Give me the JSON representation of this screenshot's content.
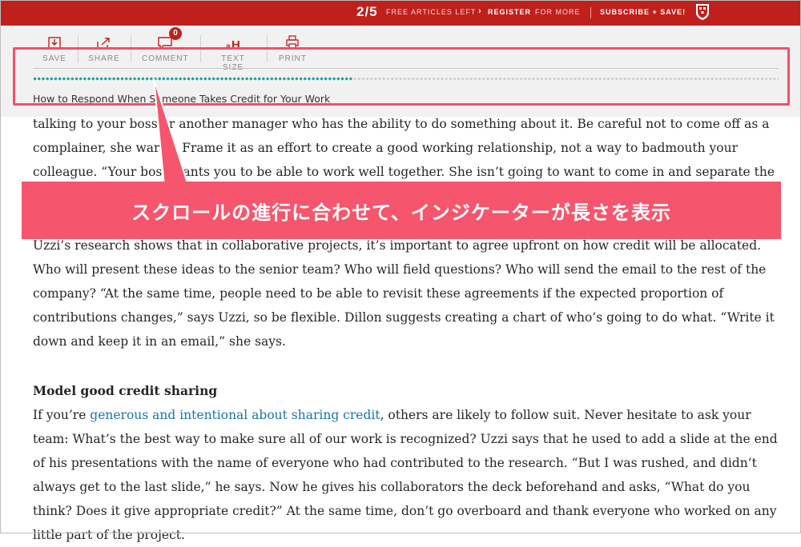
{
  "topbar": {
    "count": "2/5",
    "free_articles": "FREE ARTICLES LEFT",
    "register": "REGISTER",
    "for_more": "FOR MORE",
    "subscribe": "SUBSCRIBE + SAVE!",
    "brand_color": "#c0201b"
  },
  "toolbar": {
    "tools": [
      {
        "label": "SAVE",
        "icon": "save-icon"
      },
      {
        "label": "SHARE",
        "icon": "share-icon"
      },
      {
        "label": "COMMENT",
        "icon": "comment-icon",
        "badge": "0"
      },
      {
        "label": "TEXT SIZE",
        "icon": "text-size-icon"
      },
      {
        "label": "PRINT",
        "icon": "print-icon"
      }
    ],
    "progress_fraction": 0.43,
    "progress_color": "#1fa3a3",
    "article_title": "How to Respond When Someone Takes Credit for Your Work"
  },
  "callout": {
    "text": "スクロールの進行に合わせて、インジケーターが長さを表示",
    "color": "#f5566d"
  },
  "article": {
    "p1": "talking to your boss or another manager who has the ability to do something about it. Be careful not to come off as a complainer, she warns. Frame it as an effort to create a good working relationship, not a way to badmouth your colleague. “Your boss wants you to be able to work well together. She isn’t going to want to come in and separate the children.”",
    "p2": "Uzzi’s research shows that in collaborative projects, it’s important to agree upfront on how credit will be allocated. Who will present these ideas to the senior team? Who will field questions? Who will send the email to the rest of the company? “At the same time, people need to be able to revisit these agreements if the expected proportion of contributions changes,” says Uzzi, so be flexible. Dillon suggests creating a chart of who’s going to do what. “Write it down and keep it in an email,” she says.",
    "heading": "Model good credit sharing",
    "p3_pre": "If you’re ",
    "p3_link": "generous and intentional about sharing credit",
    "p3_post": ", others are likely to follow suit. Never hesitate to ask your team: What’s the best way to make sure all of our work is recognized? Uzzi says that he used to add a slide at the end of his presentations with the name of everyone who had contributed to the research. “But I was rushed, and didn’t always get to the last slide,” he says. Now he gives his collaborators the deck beforehand and asks, “What do you think? Does it give appropriate credit?” At the same time, don’t go overboard and thank everyone who worked on any little part of the project."
  }
}
